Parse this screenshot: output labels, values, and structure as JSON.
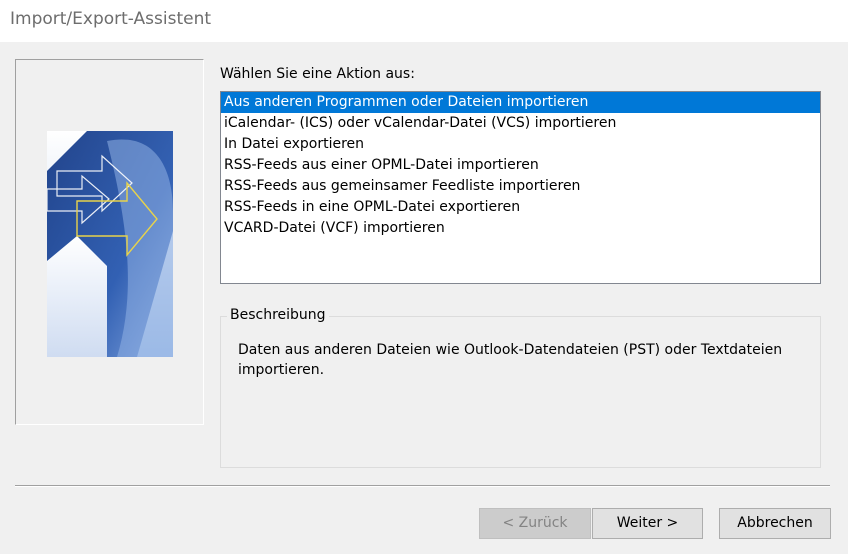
{
  "window": {
    "title": "Import/Export-Assistent"
  },
  "main": {
    "prompt": "Wählen Sie eine Aktion aus:",
    "actions": [
      {
        "label": "Aus anderen Programmen oder Dateien importieren",
        "selected": true
      },
      {
        "label": "iCalendar- (ICS) oder vCalendar-Datei (VCS) importieren",
        "selected": false
      },
      {
        "label": "In Datei exportieren",
        "selected": false
      },
      {
        "label": "RSS-Feeds aus einer OPML-Datei importieren",
        "selected": false
      },
      {
        "label": "RSS-Feeds aus gemeinsamer Feedliste importieren",
        "selected": false
      },
      {
        "label": "RSS-Feeds in eine OPML-Datei exportieren",
        "selected": false
      },
      {
        "label": "VCARD-Datei (VCF) importieren",
        "selected": false
      }
    ],
    "description": {
      "legend": "Beschreibung",
      "text": "Daten aus anderen Dateien wie Outlook-Datendateien (PST) oder Textdateien importieren."
    }
  },
  "buttons": {
    "back": "< Zurück",
    "next": "Weiter >",
    "cancel": "Abbrechen"
  },
  "colors": {
    "selection": "#0078d7",
    "art_dark_blue": "#1e4a9a",
    "art_light_blue": "#a9c4ea",
    "art_arrow_yellow": "#e8d34a"
  }
}
